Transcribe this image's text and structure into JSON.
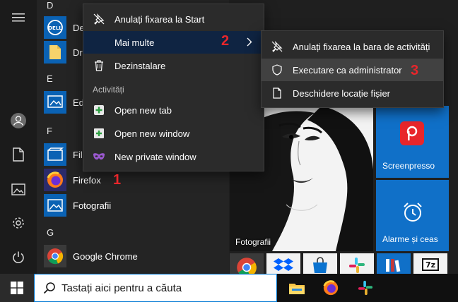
{
  "start_menu": {
    "app_list": {
      "letters": [
        "D",
        "E",
        "F",
        "G"
      ],
      "apps": [
        {
          "label": "De",
          "icon": "dell-icon"
        },
        {
          "label": "Dr",
          "icon": "folder-icon"
        },
        {
          "label": "Ed",
          "icon": "edge-icon"
        },
        {
          "label": "Fil",
          "icon": "films-icon"
        },
        {
          "label": "Firefox",
          "icon": "firefox-icon"
        },
        {
          "label": "Fotografii",
          "icon": "photos-icon"
        },
        {
          "label": "Google Chrome",
          "icon": "chrome-icon"
        }
      ]
    },
    "tiles": {
      "photo_caption": "Fotografii",
      "screenpresso_label": "Screenpresso",
      "alarms_label": "Alarme și ceas"
    }
  },
  "context_menu": {
    "items": [
      {
        "label": "Anulați fixarea la Start",
        "icon": "unpin-icon"
      },
      {
        "label": "Mai multe",
        "icon": "",
        "submenu": true
      },
      {
        "label": "Dezinstalare",
        "icon": "trash-icon"
      }
    ],
    "section_title": "Activități",
    "tasks": [
      {
        "label": "Open new tab",
        "icon": "new-tab-icon"
      },
      {
        "label": "Open new window",
        "icon": "new-window-icon"
      },
      {
        "label": "New private window",
        "icon": "private-mask-icon"
      }
    ]
  },
  "submenu": {
    "items": [
      {
        "label": "Anulați fixarea la bara de activități",
        "icon": "unpin-icon"
      },
      {
        "label": "Executare ca administrator",
        "icon": "shield-icon"
      },
      {
        "label": "Deschidere locație fișier",
        "icon": "file-location-icon"
      }
    ]
  },
  "step_badges": [
    "1",
    "2",
    "3"
  ],
  "taskbar": {
    "search_placeholder": "Tastați aici pentru a căuta"
  },
  "colors": {
    "accent": "#0078d4",
    "tile_blue": "#1070c8",
    "screenpresso_red": "#e8262b",
    "badge_red": "#e8262b",
    "menu_bg": "#2b2b2b"
  }
}
